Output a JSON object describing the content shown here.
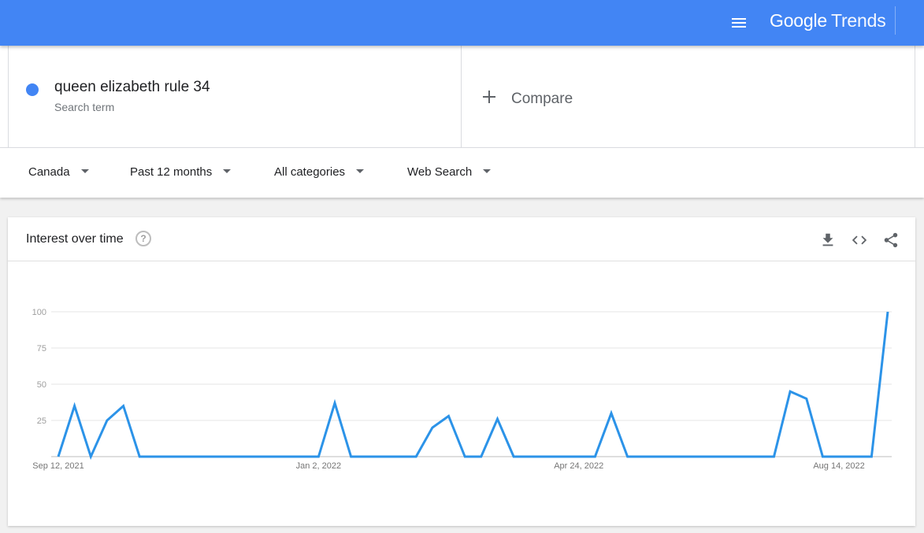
{
  "header": {
    "brand_google": "Google",
    "brand_trends": "Trends",
    "menu_icon": "hamburger-menu-icon"
  },
  "term": {
    "title": "queen elizabeth rule 34",
    "subtitle": "Search term",
    "color": "#4285f4"
  },
  "compare": {
    "label": "Compare",
    "icon": "plus-icon"
  },
  "filters": [
    {
      "label": "Canada"
    },
    {
      "label": "Past 12 months"
    },
    {
      "label": "All categories"
    },
    {
      "label": "Web Search"
    }
  ],
  "card": {
    "title": "Interest over time",
    "icons": [
      "help-icon",
      "download-icon",
      "embed-code-icon",
      "share-icon"
    ]
  },
  "chart_data": {
    "type": "line",
    "title": "",
    "xlabel": "",
    "ylabel": "",
    "ylim": [
      0,
      100
    ],
    "yticks": [
      25,
      50,
      75,
      100
    ],
    "grid": true,
    "line_color": "#2c93e8",
    "x_tick_labels": [
      {
        "label": "Sep 12, 2021",
        "index": 0
      },
      {
        "label": "Jan 2, 2022",
        "index": 16
      },
      {
        "label": "Apr 24, 2022",
        "index": 32
      },
      {
        "label": "Aug 14, 2022",
        "index": 48
      }
    ],
    "series": [
      {
        "values": [
          0,
          35,
          0,
          25,
          35,
          0,
          0,
          0,
          0,
          0,
          0,
          0,
          0,
          0,
          0,
          0,
          0,
          37,
          0,
          0,
          0,
          0,
          0,
          20,
          28,
          0,
          0,
          26,
          0,
          0,
          0,
          0,
          0,
          0,
          30,
          0,
          0,
          0,
          0,
          0,
          0,
          0,
          0,
          0,
          0,
          45,
          40,
          0,
          0,
          0,
          0,
          100
        ]
      }
    ]
  }
}
